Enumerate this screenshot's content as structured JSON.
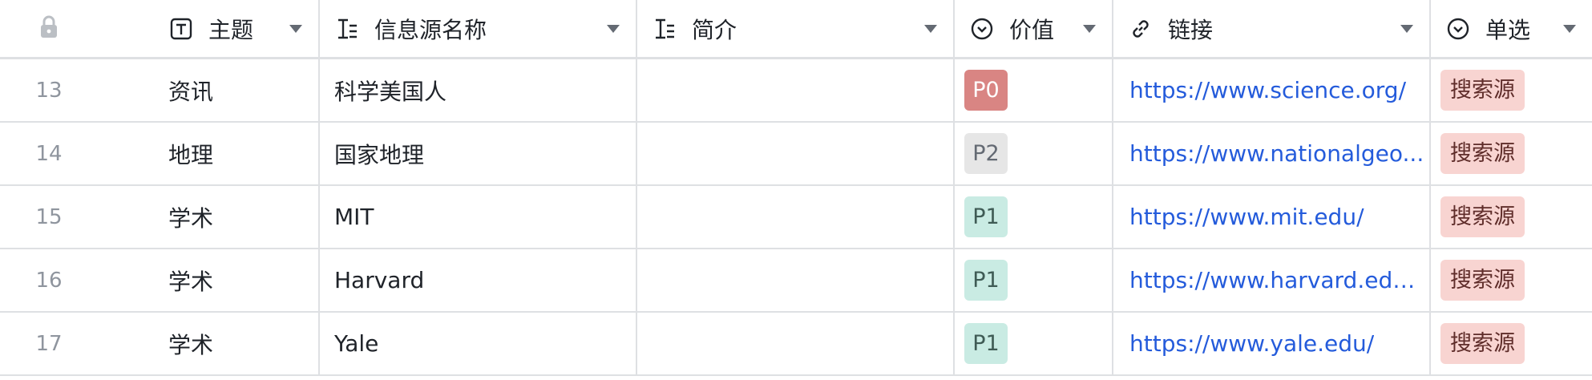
{
  "header": {
    "columns": [
      {
        "label": "主题",
        "icon": "text-type-icon"
      },
      {
        "label": "信息源名称",
        "icon": "long-text-icon"
      },
      {
        "label": "简介",
        "icon": "long-text-icon"
      },
      {
        "label": "价值",
        "icon": "single-select-icon"
      },
      {
        "label": "链接",
        "icon": "link-icon"
      },
      {
        "label": "单选",
        "icon": "single-select-icon"
      }
    ]
  },
  "rows": [
    {
      "index": "13",
      "topic": "资讯",
      "name": "科学美国人",
      "desc": "",
      "value": "P0",
      "link": "https://www.science.org/",
      "single": "搜索源"
    },
    {
      "index": "14",
      "topic": "地理",
      "name": "国家地理",
      "desc": "",
      "value": "P2",
      "link": "https://www.nationalgeo...",
      "single": "搜索源"
    },
    {
      "index": "15",
      "topic": "学术",
      "name": "MIT",
      "desc": "",
      "value": "P1",
      "link": "https://www.mit.edu/",
      "single": "搜索源"
    },
    {
      "index": "16",
      "topic": "学术",
      "name": "Harvard",
      "desc": "",
      "value": "P1",
      "link": "https://www.harvard.edu...",
      "single": "搜索源"
    },
    {
      "index": "17",
      "topic": "学术",
      "name": "Yale",
      "desc": "",
      "value": "P1",
      "link": "https://www.yale.edu/",
      "single": "搜索源"
    }
  ],
  "colors": {
    "P0_bg": "#d98583",
    "P0_fg": "#ffffff",
    "P1_bg": "#c9ebe3",
    "P1_fg": "#3f5b55",
    "P2_bg": "#e6e6e6",
    "P2_fg": "#646a73",
    "link": "#245bdb",
    "single_bg": "#f8d4d1"
  }
}
